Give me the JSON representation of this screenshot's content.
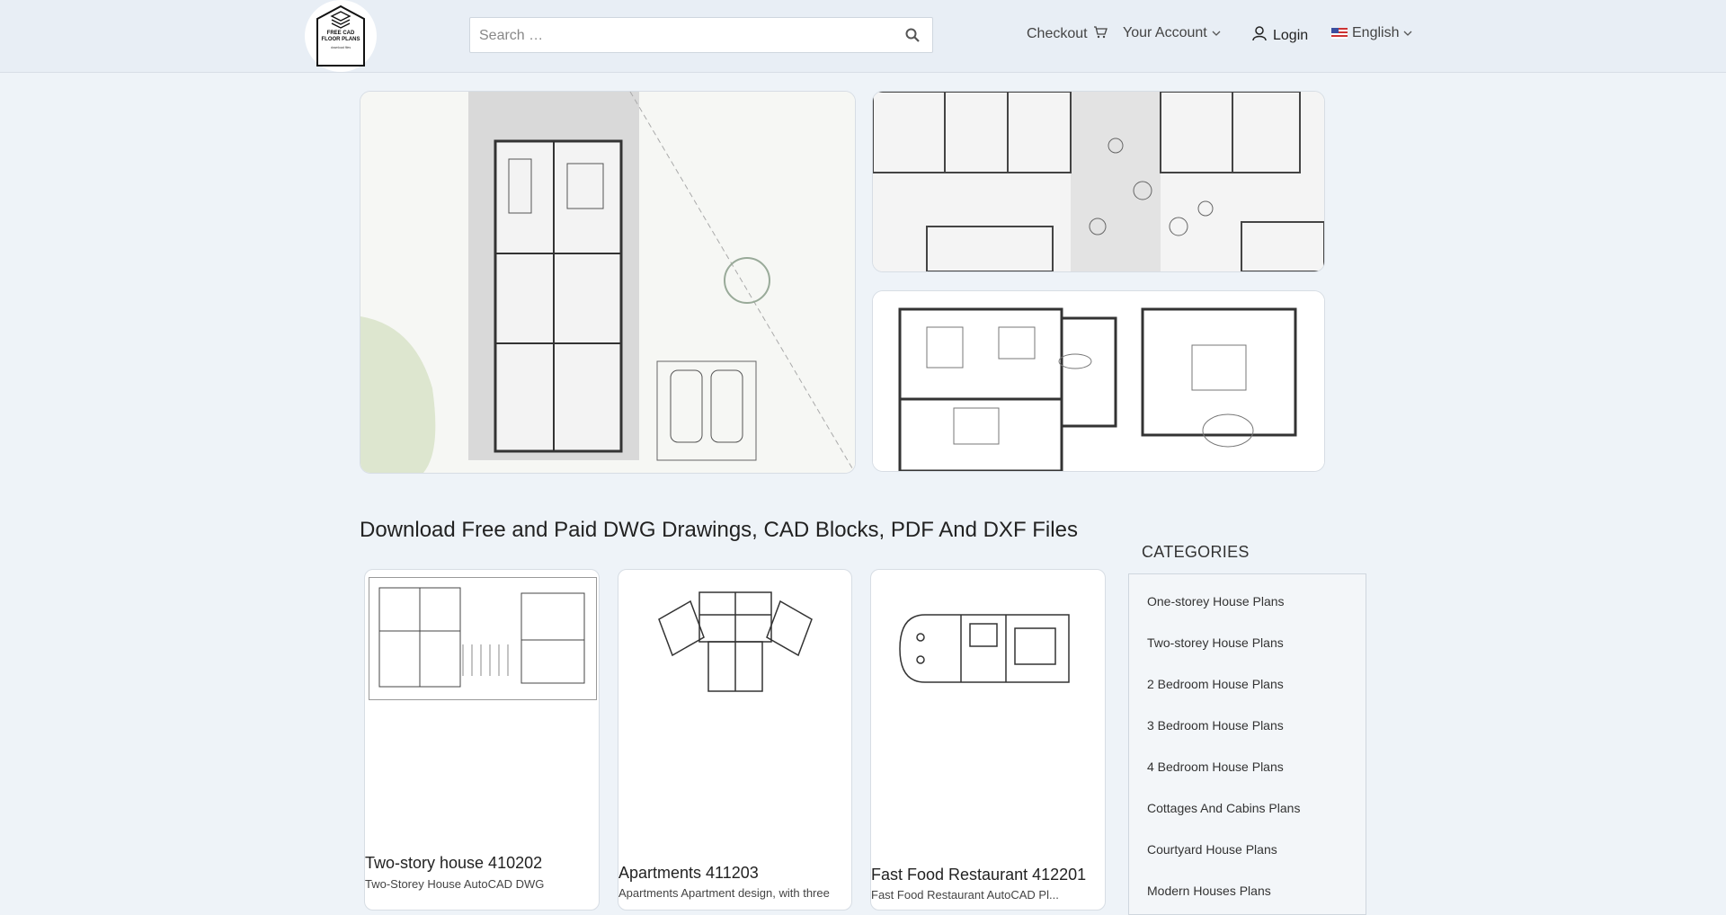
{
  "header": {
    "logo": {
      "line1": "FREE CAD",
      "line2": "FLOOR PLANS",
      "line3": "download files"
    },
    "search_placeholder": "Search …",
    "checkout_label": "Checkout",
    "account_label": "Your Account",
    "login_label": "Login",
    "language_label": "English"
  },
  "main": {
    "heading": "Download Free and Paid DWG Drawings, CAD Blocks, PDF And DXF Files",
    "products": [
      {
        "title": "Two-story house 410202",
        "desc": "Two-Storey House AutoCAD DWG"
      },
      {
        "title": "Apartments 411203",
        "desc": "Apartments Apartment design, with three"
      },
      {
        "title": "Fast Food Restaurant 412201",
        "desc": "Fast Food Restaurant AutoCAD Pl..."
      }
    ]
  },
  "sidebar": {
    "title": "CATEGORIES",
    "items": [
      {
        "label": "One-storey House Plans"
      },
      {
        "label": "Two-storey House Plans"
      },
      {
        "label": "2 Bedroom House Plans"
      },
      {
        "label": "3 Bedroom House Plans"
      },
      {
        "label": "4 Bedroom House Plans"
      },
      {
        "label": "Cottages And Cabins Plans"
      },
      {
        "label": "Courtyard House Plans"
      },
      {
        "label": "Modern Houses Plans"
      }
    ]
  }
}
